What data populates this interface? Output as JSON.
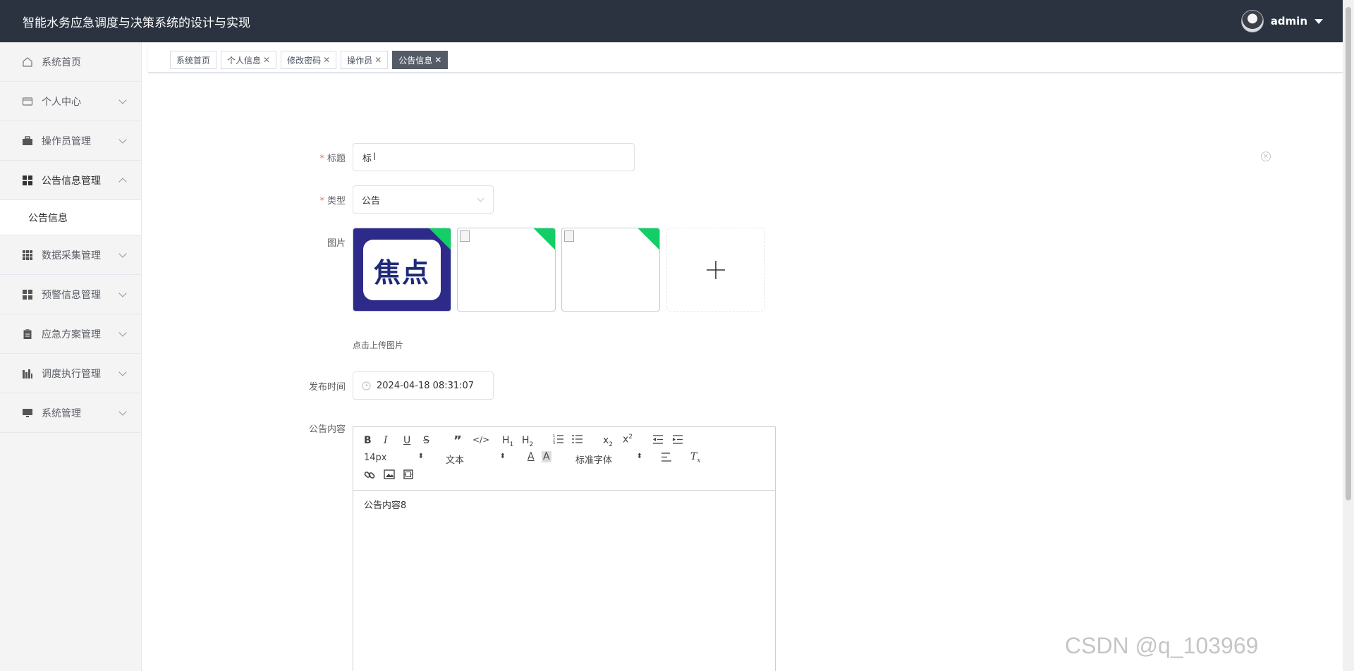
{
  "header": {
    "title": "智能水务应急调度与决策系统的设计与实现",
    "user": "admin"
  },
  "sidebar": {
    "items": [
      {
        "label": "系统首页",
        "icon": "home-icon"
      },
      {
        "label": "个人中心",
        "icon": "card-icon"
      },
      {
        "label": "操作员管理",
        "icon": "briefcase-icon"
      },
      {
        "label": "公告信息管理",
        "icon": "grid-icon",
        "expanded": true
      },
      {
        "label": "数据采集管理",
        "icon": "apps-icon"
      },
      {
        "label": "预警信息管理",
        "icon": "grid-icon"
      },
      {
        "label": "应急方案管理",
        "icon": "clipboard-icon"
      },
      {
        "label": "调度执行管理",
        "icon": "chart-icon"
      },
      {
        "label": "系统管理",
        "icon": "monitor-icon"
      }
    ],
    "subitem": "公告信息"
  },
  "tabs": [
    {
      "label": "系统首页",
      "closable": false
    },
    {
      "label": "个人信息",
      "closable": true
    },
    {
      "label": "修改密码",
      "closable": true
    },
    {
      "label": "操作员",
      "closable": true
    },
    {
      "label": "公告信息",
      "closable": true,
      "active": true
    }
  ],
  "form": {
    "title_label": "标题",
    "title_value": "标",
    "type_label": "类型",
    "type_value": "公告",
    "image_label": "图片",
    "logo_text": "焦点",
    "upload_tip": "点击上传图片",
    "time_label": "发布时间",
    "time_value": "2024-04-18 08:31:07",
    "content_label": "公告内容",
    "content_value": "公告内容8"
  },
  "editor": {
    "font_size": "14px",
    "header_select": "文本",
    "font_family": "标准字体"
  },
  "watermark": "CSDN @q_103969",
  "colors": {
    "header_bg": "#2b3340",
    "accent_green": "#13ce66",
    "required": "#f56c6c",
    "active_tab": "#555b66"
  }
}
